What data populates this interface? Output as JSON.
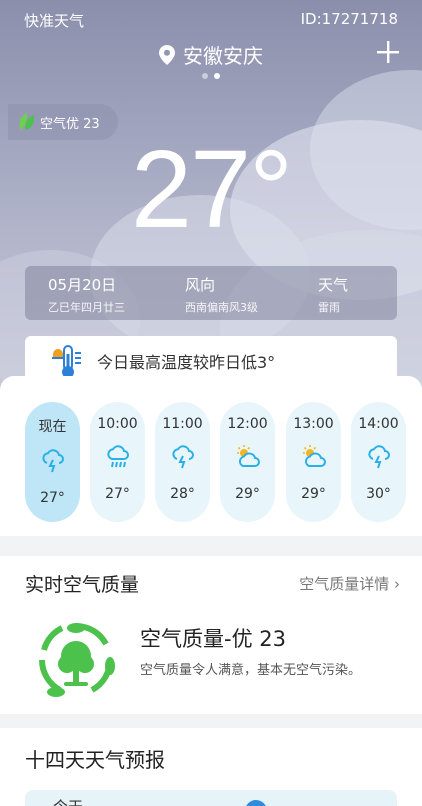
{
  "status": {
    "app_name": "快准天气",
    "device_id": "ID:17271718"
  },
  "header": {
    "location": "安徽安庆",
    "page_dots": 2,
    "active_dot": 2
  },
  "current": {
    "aqi_badge": "空气优 23",
    "temperature": "27°",
    "date": "05月20日",
    "lunar_date": "乙巳年四月廿三",
    "wind_label": "风向",
    "wind_value": "西南偏南风3级",
    "weather_label": "天气",
    "weather_value": "雷雨"
  },
  "notice": {
    "text": "今日最高温度较昨日低3°"
  },
  "hourly": [
    {
      "time": "现在",
      "icon": "thunder-icon",
      "temp": "27°"
    },
    {
      "time": "10:00",
      "icon": "heavy-rain-icon",
      "temp": "27°"
    },
    {
      "time": "11:00",
      "icon": "thunder-icon",
      "temp": "28°"
    },
    {
      "time": "12:00",
      "icon": "partly-cloudy-icon",
      "temp": "29°"
    },
    {
      "time": "13:00",
      "icon": "partly-cloudy-icon",
      "temp": "29°"
    },
    {
      "time": "14:00",
      "icon": "thunder-icon",
      "temp": "30°"
    }
  ],
  "air_quality": {
    "title": "实时空气质量",
    "detail_link": "空气质量详情",
    "headline": "空气质量-优 23",
    "description": "空气质量令人满意，基本无空气污染。"
  },
  "forecast": {
    "title": "十四天天气预报",
    "first_row": "今天"
  },
  "colors": {
    "accent": "#29b0e8",
    "hour_bg": "#e8f5fb",
    "hour_current_bg": "#bfe6f6",
    "leaf_green": "#4cc24c"
  }
}
